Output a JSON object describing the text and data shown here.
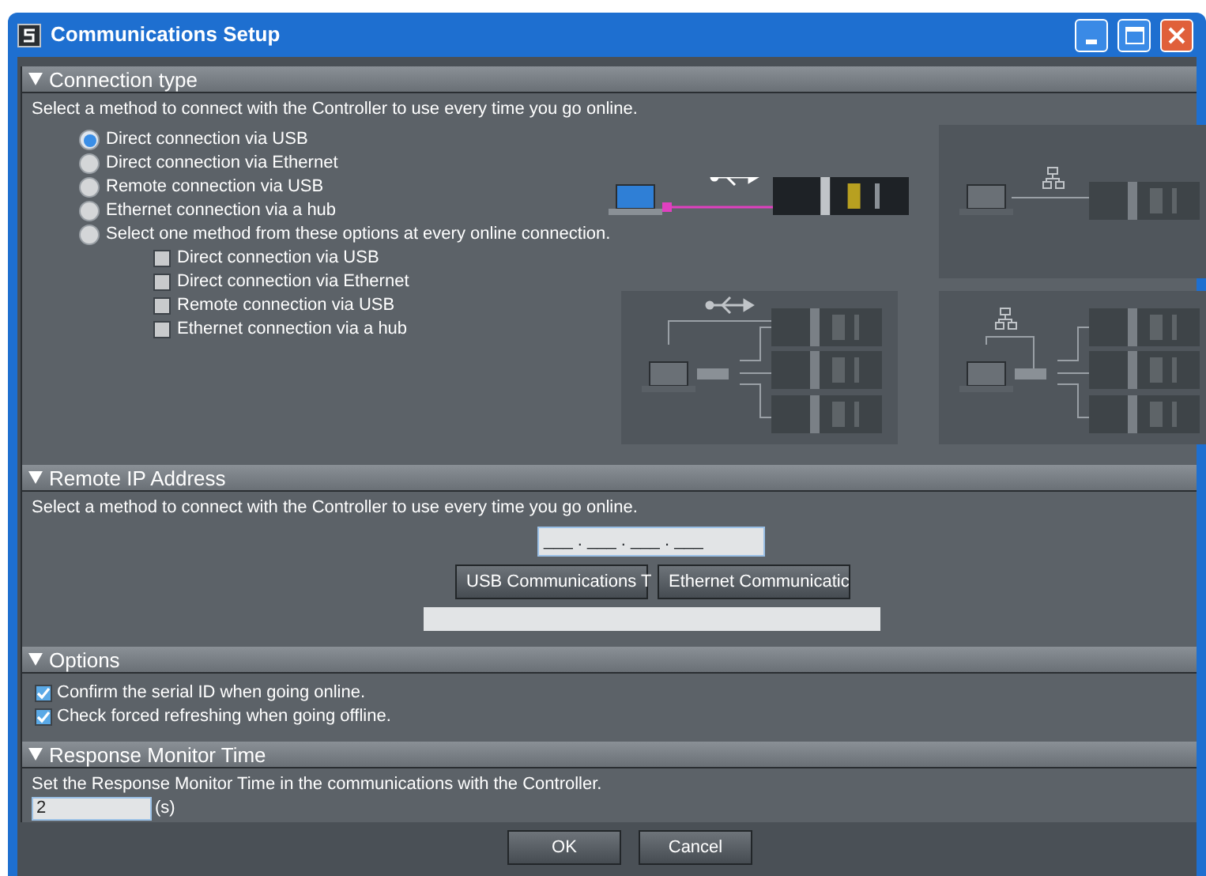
{
  "window": {
    "title": "Communications Setup"
  },
  "connection_type": {
    "title": "Connection type",
    "expanded": true,
    "description": "Select a method to connect with the Controller to use every time you go online.",
    "options": [
      {
        "label": "Direct connection via USB",
        "selected": true
      },
      {
        "label": "Direct connection via Ethernet",
        "selected": false
      },
      {
        "label": "Remote connection via USB",
        "selected": false
      },
      {
        "label": "Ethernet connection via a hub",
        "selected": false
      },
      {
        "label": "Select one method from these options at every online connection.",
        "selected": false
      }
    ],
    "sub_options": [
      {
        "label": "Direct connection via USB",
        "checked": false
      },
      {
        "label": "Direct connection via Ethernet",
        "checked": false
      },
      {
        "label": "Remote connection via USB",
        "checked": false
      },
      {
        "label": "Ethernet connection via a hub",
        "checked": false
      }
    ]
  },
  "remote_ip": {
    "title": "Remote IP Address",
    "expanded": true,
    "description": "Select a method to connect with the Controller to use every time you go online.",
    "ip_value": "___ . ___ . ___ . ___",
    "buttons": [
      "USB Communications T",
      "Ethernet Communicatic"
    ]
  },
  "options": {
    "title": "Options",
    "expanded": true,
    "items": [
      {
        "label": "Confirm the serial ID when going online.",
        "checked": true
      },
      {
        "label": "Check forced refreshing when going offline.",
        "checked": true
      }
    ]
  },
  "response_monitor": {
    "title": "Response Monitor Time",
    "expanded": true,
    "description": "Set the Response Monitor Time in the communications with the Controller.",
    "value": "2",
    "unit": "(s)"
  },
  "buttons": [
    "OK",
    "Cancel"
  ]
}
